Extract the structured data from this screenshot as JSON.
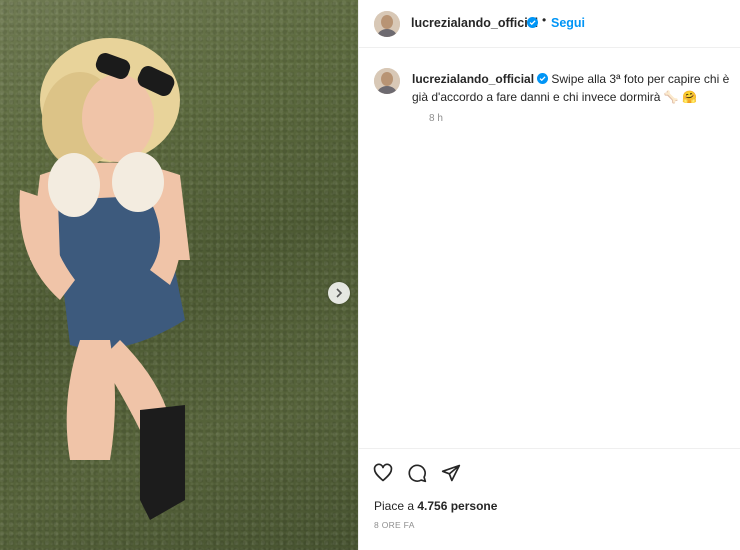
{
  "post": {
    "image_alt": "Donna bionda con occhiali da sole che tiene due cuccioli bianchi, inginocchiata sull'erba",
    "next_icon": "chevron-right-icon"
  },
  "header": {
    "username": "lucrezialando_official",
    "verified_icon": "verified-badge-icon",
    "separator": "•",
    "follow_label": "Segui"
  },
  "caption": {
    "username": "lucrezialando_official",
    "text": "Swipe alla 3ª foto per capire chi è già d'accordo a fare danni e chi invece dormirà 🦴 🤗",
    "time": "8 h"
  },
  "actions": {
    "like_icon": "heart-icon",
    "comment_icon": "comment-icon",
    "share_icon": "share-icon",
    "likes_prefix": "Piace a ",
    "likes_count": "4.756 persone",
    "timestamp": "8 ORE FA"
  },
  "colors": {
    "accent": "#0095f6",
    "text": "#262626",
    "muted": "#8e8e8e",
    "border": "#efefef"
  }
}
